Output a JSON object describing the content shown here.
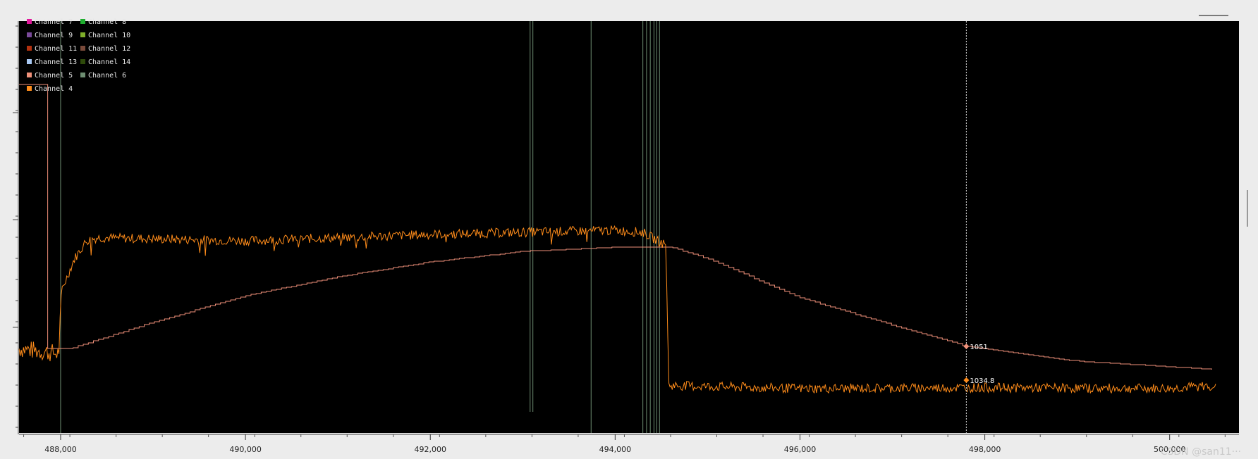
{
  "chart_data": {
    "type": "line",
    "x_ticks": [
      "488,000",
      "490,000",
      "492,000",
      "494,000",
      "496,000",
      "498,000",
      "500,000"
    ],
    "xlim": [
      487550,
      500750
    ],
    "ylim": [
      -0.8,
      3.1
    ],
    "legend": [
      {
        "name": "Channel 7",
        "color": "#e0199b"
      },
      {
        "name": "Channel 8",
        "color": "#1fae2f"
      },
      {
        "name": "Channel 9",
        "color": "#7a4a9a"
      },
      {
        "name": "Channel 10",
        "color": "#7fae2a"
      },
      {
        "name": "Channel 11",
        "color": "#b2310f"
      },
      {
        "name": "Channel 12",
        "color": "#7a4a3a"
      },
      {
        "name": "Channel 13",
        "color": "#a9c8f2"
      },
      {
        "name": "Channel 14",
        "color": "#2e4a0a"
      },
      {
        "name": "Channel 5",
        "color": "#f0917a"
      },
      {
        "name": "Channel 6",
        "color": "#6e8e72"
      },
      {
        "name": "Channel 4",
        "color": "#ff8c1a"
      }
    ],
    "legend_placement": "top-left",
    "series": [
      {
        "name": "Channel 4",
        "color": "#ff8c1a",
        "points": [
          [
            487550,
            0.0
          ],
          [
            487980,
            -0.05
          ],
          [
            488010,
            0.55
          ],
          [
            488150,
            0.85
          ],
          [
            488280,
            1.02
          ],
          [
            488400,
            1.05
          ],
          [
            490000,
            1.02
          ],
          [
            491000,
            1.05
          ],
          [
            492000,
            1.08
          ],
          [
            493000,
            1.1
          ],
          [
            494000,
            1.12
          ],
          [
            494300,
            1.1
          ],
          [
            494500,
            1.0
          ],
          [
            494550,
            0.98
          ],
          [
            494580,
            -0.35
          ],
          [
            496000,
            -0.38
          ],
          [
            498000,
            -0.37
          ],
          [
            500000,
            -0.38
          ],
          [
            500500,
            -0.35
          ]
        ]
      },
      {
        "name": "Channel 5",
        "color": "#f0917a",
        "points": [
          [
            487550,
            2.5
          ],
          [
            487860,
            2.5
          ],
          [
            487860,
            0.0
          ],
          [
            488100,
            0.0
          ],
          [
            489000,
            0.25
          ],
          [
            490000,
            0.5
          ],
          [
            491000,
            0.68
          ],
          [
            492000,
            0.82
          ],
          [
            493000,
            0.92
          ],
          [
            494000,
            0.96
          ],
          [
            494600,
            0.96
          ],
          [
            495000,
            0.85
          ],
          [
            496000,
            0.48
          ],
          [
            497000,
            0.22
          ],
          [
            497800,
            0.02
          ],
          [
            499000,
            -0.12
          ],
          [
            500500,
            -0.2
          ]
        ]
      }
    ],
    "vertical_lines": [
      {
        "series": "Channel 6",
        "color": "#6e8e72",
        "x": [
          488000,
          493080,
          493110,
          493740,
          494300,
          494340,
          494380,
          494420,
          494450,
          494480
        ]
      }
    ],
    "cursor": {
      "x": 497800,
      "labels": [
        {
          "series": "Channel 5",
          "value": "1051",
          "y": 0.02
        },
        {
          "series": "Channel 4",
          "value": "1034.8",
          "y": -0.3
        }
      ]
    }
  },
  "watermark": "CSDN @san11···"
}
